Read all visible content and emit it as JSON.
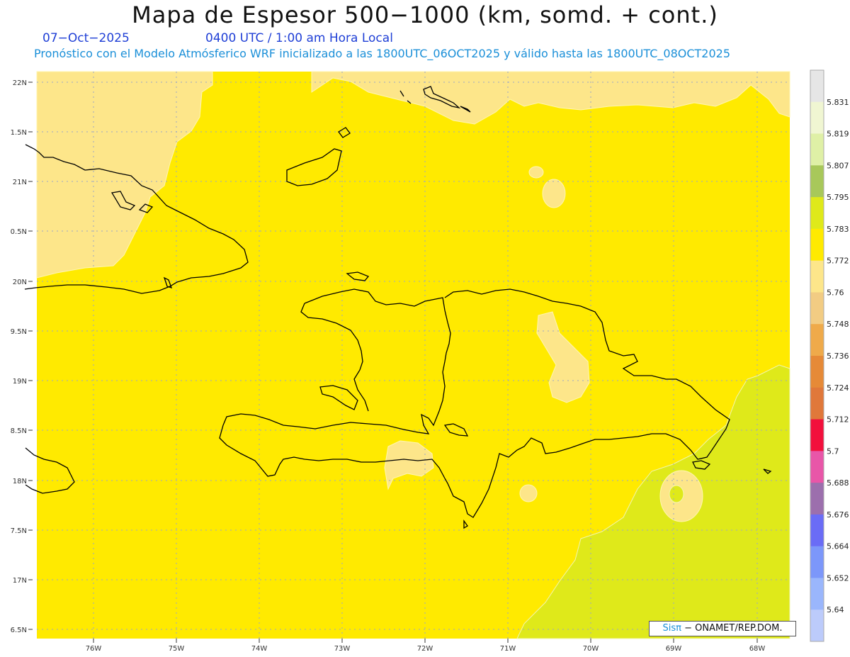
{
  "header": {
    "title": "Mapa de Espesor 500−1000 (km, somd. + cont.)",
    "date": "07−Oct−2025",
    "time": "0400 UTC / 1:00 am Hora Local",
    "description": "Pronóstico con el Modelo Atmósferico WRF inicializado a las 1800UTC_06OCT2025 y válido hasta las  1800UTC_08OCT2025"
  },
  "map": {
    "lat_labels": [
      "22N",
      "1.5N",
      "21N",
      "0.5N",
      "20N",
      "9.5N",
      "19N",
      "8.5N",
      "18N",
      "7.5N",
      "17N",
      "6.5N"
    ],
    "lon_labels": [
      "76W",
      "75W",
      "74W",
      "73W",
      "72W",
      "71W",
      "70W",
      "69W",
      "68W"
    ],
    "colors": {
      "main_yellow": "#ffea00",
      "light_yellow": "#fde68a",
      "green_yellow": "#dfe91a",
      "coast": "#000000",
      "grid": "#9aa6c6"
    }
  },
  "colorbar": {
    "levels": [
      "5.831",
      "5.819",
      "5.807",
      "5.795",
      "5.783",
      "5.772",
      "5.76",
      "5.748",
      "5.736",
      "5.724",
      "5.712",
      "5.7",
      "5.688",
      "5.676",
      "5.664",
      "5.652",
      "5.64"
    ],
    "colors": [
      "#e6e6e6",
      "#f0f6d2",
      "#dff0a6",
      "#a8c85a",
      "#dfe91a",
      "#ffea00",
      "#fde68a",
      "#f2cc83",
      "#efaa4a",
      "#e68a37",
      "#e0783a",
      "#f2103c",
      "#e856a8",
      "#9c6fad",
      "#6a6cf6",
      "#7c97fa",
      "#9ab6fc",
      "#bccbfb"
    ]
  },
  "credit": {
    "brand": "Sisπ",
    "text": "− ONAMET/REP.DOM."
  }
}
